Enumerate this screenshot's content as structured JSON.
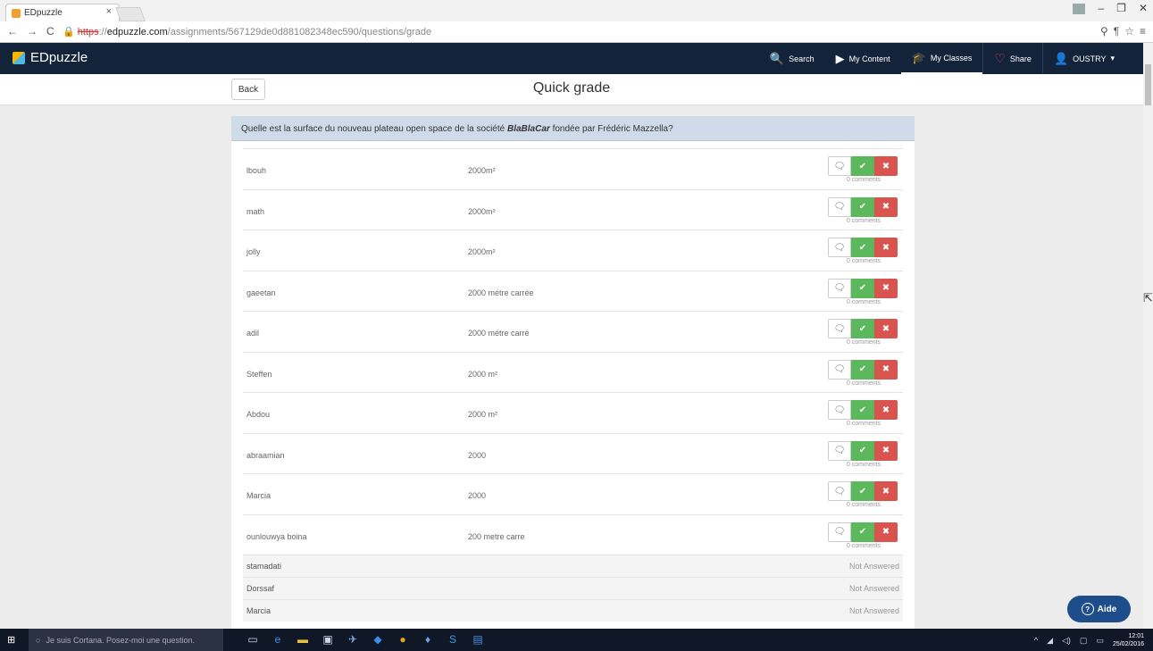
{
  "browser": {
    "tab_title": "EDpuzzle",
    "tab_close": "×",
    "url_prefix": "https",
    "url_rest": "://",
    "url_host": "edpuzzle.com",
    "url_path": "/assignments/567129de0d881082348ec590/questions/grade"
  },
  "navbar": {
    "brand": "EDpuzzle",
    "search": "Search",
    "my_content": "My Content",
    "my_classes": "My Classes",
    "share": "Share",
    "user": "OUSTRY"
  },
  "header": {
    "back": "Back",
    "title": "Quick grade"
  },
  "question": {
    "before": "Quelle est la surface du nouveau plateau open space de la société ",
    "emph": "BlaBlaCar",
    "after": " fondée par Frédéric Mazzella?"
  },
  "rows": [
    {
      "name": "lbouh",
      "answer": "2000m²",
      "comments": "0 comments"
    },
    {
      "name": "math",
      "answer": "2000m²",
      "comments": "0 comments"
    },
    {
      "name": "jolly",
      "answer": "2000m²",
      "comments": "0 comments"
    },
    {
      "name": "gaeetan",
      "answer": "2000 métre carrée",
      "comments": "0 comments"
    },
    {
      "name": "adil",
      "answer": "2000 métre carré",
      "comments": "0 comments"
    },
    {
      "name": "Steffen",
      "answer": "2000 m²",
      "comments": "0 comments"
    },
    {
      "name": "Abdou",
      "answer": "2000 m²",
      "comments": "0 comments"
    },
    {
      "name": "abraamian",
      "answer": "2000",
      "comments": "0 comments"
    },
    {
      "name": "Marcia",
      "answer": "2000",
      "comments": "0 comments"
    },
    {
      "name": "ounlouwya boina",
      "answer": "200 metre carre",
      "comments": "0 comments"
    }
  ],
  "not_answered": [
    {
      "name": "stamadati",
      "status": "Not Answered"
    },
    {
      "name": "Dorssaf",
      "status": "Not Answered"
    },
    {
      "name": "Marcia",
      "status": "Not Answered"
    }
  ],
  "help": {
    "label": "Aide"
  },
  "taskbar": {
    "cortana": "Je suis Cortana. Posez-moi une question.",
    "time": "12:01",
    "date": "25/02/2016"
  },
  "colors": {
    "navbar": "#13233a",
    "correct": "#5cb85c",
    "incorrect": "#d9534f",
    "question_bg": "#cfdbe8"
  }
}
